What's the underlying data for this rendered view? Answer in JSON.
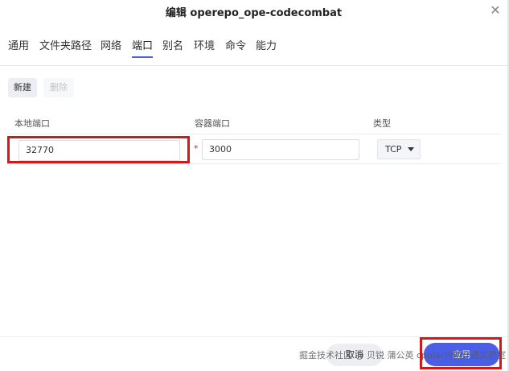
{
  "dialog": {
    "title": "编辑 operepo_ope-codecombat",
    "close_glyph": "✕"
  },
  "tabs": [
    {
      "label": "通用"
    },
    {
      "label": "文件夹路径"
    },
    {
      "label": "网络"
    },
    {
      "label": "端口",
      "active": true
    },
    {
      "label": "别名"
    },
    {
      "label": "环境"
    },
    {
      "label": "命令"
    },
    {
      "label": "能力"
    }
  ],
  "toolbar": {
    "new_label": "新建",
    "delete_label": "删除"
  },
  "table": {
    "headers": {
      "local_port": "本地端口",
      "container_port": "容器端口",
      "type": "类型"
    },
    "rows": [
      {
        "local_port": "32770",
        "container_port": "3000",
        "type": "TCP"
      }
    ],
    "required_mark": "*"
  },
  "footer": {
    "cancel_label": "取消",
    "save_label": "应用"
  },
  "watermark": "掘金技术社区 @ 贝锐 蒲公英 cpolar内网穿透实验室",
  "colors": {
    "accent": "#4a5fe6",
    "highlight": "#d0191b"
  }
}
